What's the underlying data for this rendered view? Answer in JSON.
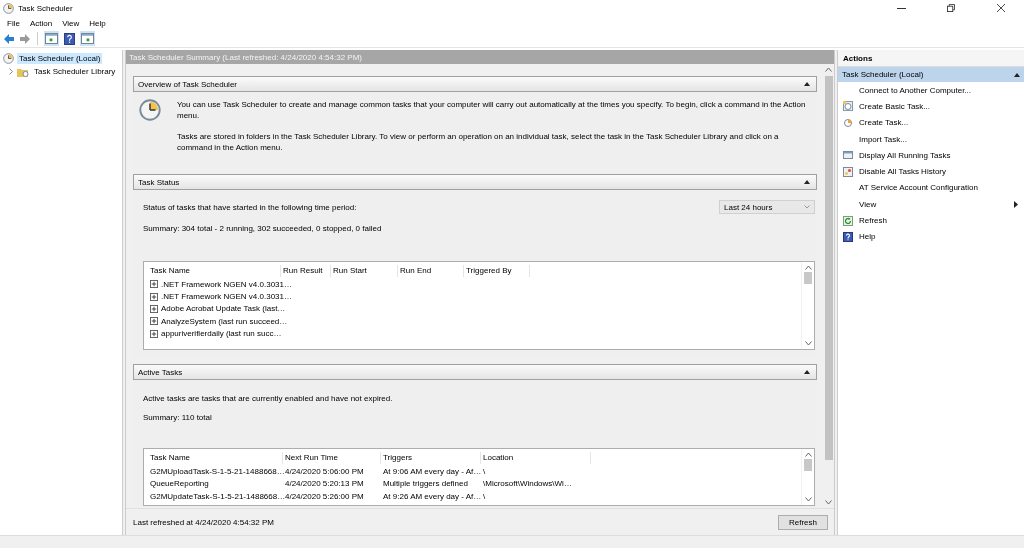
{
  "window": {
    "title": "Task Scheduler"
  },
  "menu": [
    "File",
    "Action",
    "View",
    "Help"
  ],
  "nav_buttons": [
    {
      "kind": "back",
      "disabled": false
    },
    {
      "kind": "forward",
      "disabled": true
    }
  ],
  "tree": [
    {
      "label": "Task Scheduler (Local)",
      "selected": true,
      "children": [
        {
          "label": "Task Scheduler Library",
          "selected": false,
          "expanded": false
        }
      ]
    }
  ],
  "summary_header": "Task Scheduler Summary (Last refreshed: 4/24/2020 4:54:32 PM)",
  "overview": {
    "title": "Overview of Task Scheduler",
    "expanded": true,
    "paragraphs": [
      "You can use Task Scheduler to create and manage common tasks that your computer will carry out automatically at the times you specify. To begin, click a command in the Action menu.",
      "Tasks are stored in folders in the Task Scheduler Library. To view or perform an operation on an individual task, select the task in the Task Scheduler Library and click on a command in the Action menu."
    ]
  },
  "task_status": {
    "title": "Task Status",
    "expanded": true,
    "prompt": "Status of tasks that have started in the following time period:",
    "period": "Last 24 hours",
    "summary": "Summary: 304 total - 2 running, 302 succeeded, 0 stopped, 0 failed",
    "table": {
      "columns": [
        "Task Name",
        "Run Result",
        "Run Start",
        "Run End",
        "Triggered By"
      ],
      "rows": [
        ".NET Framework NGEN v4.0.3031…",
        ".NET Framework NGEN v4.0.3031…",
        "Adobe Acrobat Update Task (last…",
        "AnalyzeSystem (last run succeed…",
        "appuriverifierdaily (last run succ…"
      ]
    }
  },
  "active_tasks": {
    "title": "Active Tasks",
    "expanded": true,
    "description": "Active tasks are tasks that are currently enabled and have not expired.",
    "summary": "Summary: 110 total",
    "table": {
      "columns": [
        "Task Name",
        "Next Run Time",
        "Triggers",
        "Location"
      ],
      "rows": [
        [
          "G2MUploadTask-S-1-5-21-1488668…",
          "4/24/2020 5:06:00 PM",
          "At 9:06 AM every day - Af…",
          "\\"
        ],
        [
          "QueueReporting",
          "4/24/2020 5:20:13 PM",
          "Multiple triggers defined",
          "\\Microsoft\\Windows\\Wi…"
        ],
        [
          "G2MUpdateTask-S-1-5-21-1488668…",
          "4/24/2020 5:26:00 PM",
          "At 9:26 AM every day - Af…",
          "\\"
        ]
      ]
    }
  },
  "footer": {
    "last_refreshed": "Last refreshed at 4/24/2020 4:54:32 PM",
    "button": "Refresh"
  },
  "actions": {
    "title": "Actions",
    "group": "Task Scheduler (Local)",
    "expanded": true,
    "items": [
      {
        "label": "Connect to Another Computer...",
        "kind": "plain"
      },
      {
        "label": "Create Basic Task...",
        "kind": "basic-task"
      },
      {
        "label": "Create Task...",
        "kind": "create-task"
      },
      {
        "label": "Import Task...",
        "kind": "plain"
      },
      {
        "label": "Display All Running Tasks",
        "kind": "running"
      },
      {
        "label": "Disable All Tasks History",
        "kind": "history"
      },
      {
        "label": "AT Service Account Configuration",
        "kind": "plain"
      },
      {
        "label": "View",
        "kind": "submenu"
      },
      {
        "label": "Refresh",
        "kind": "refresh"
      },
      {
        "label": "Help",
        "kind": "help"
      }
    ]
  }
}
